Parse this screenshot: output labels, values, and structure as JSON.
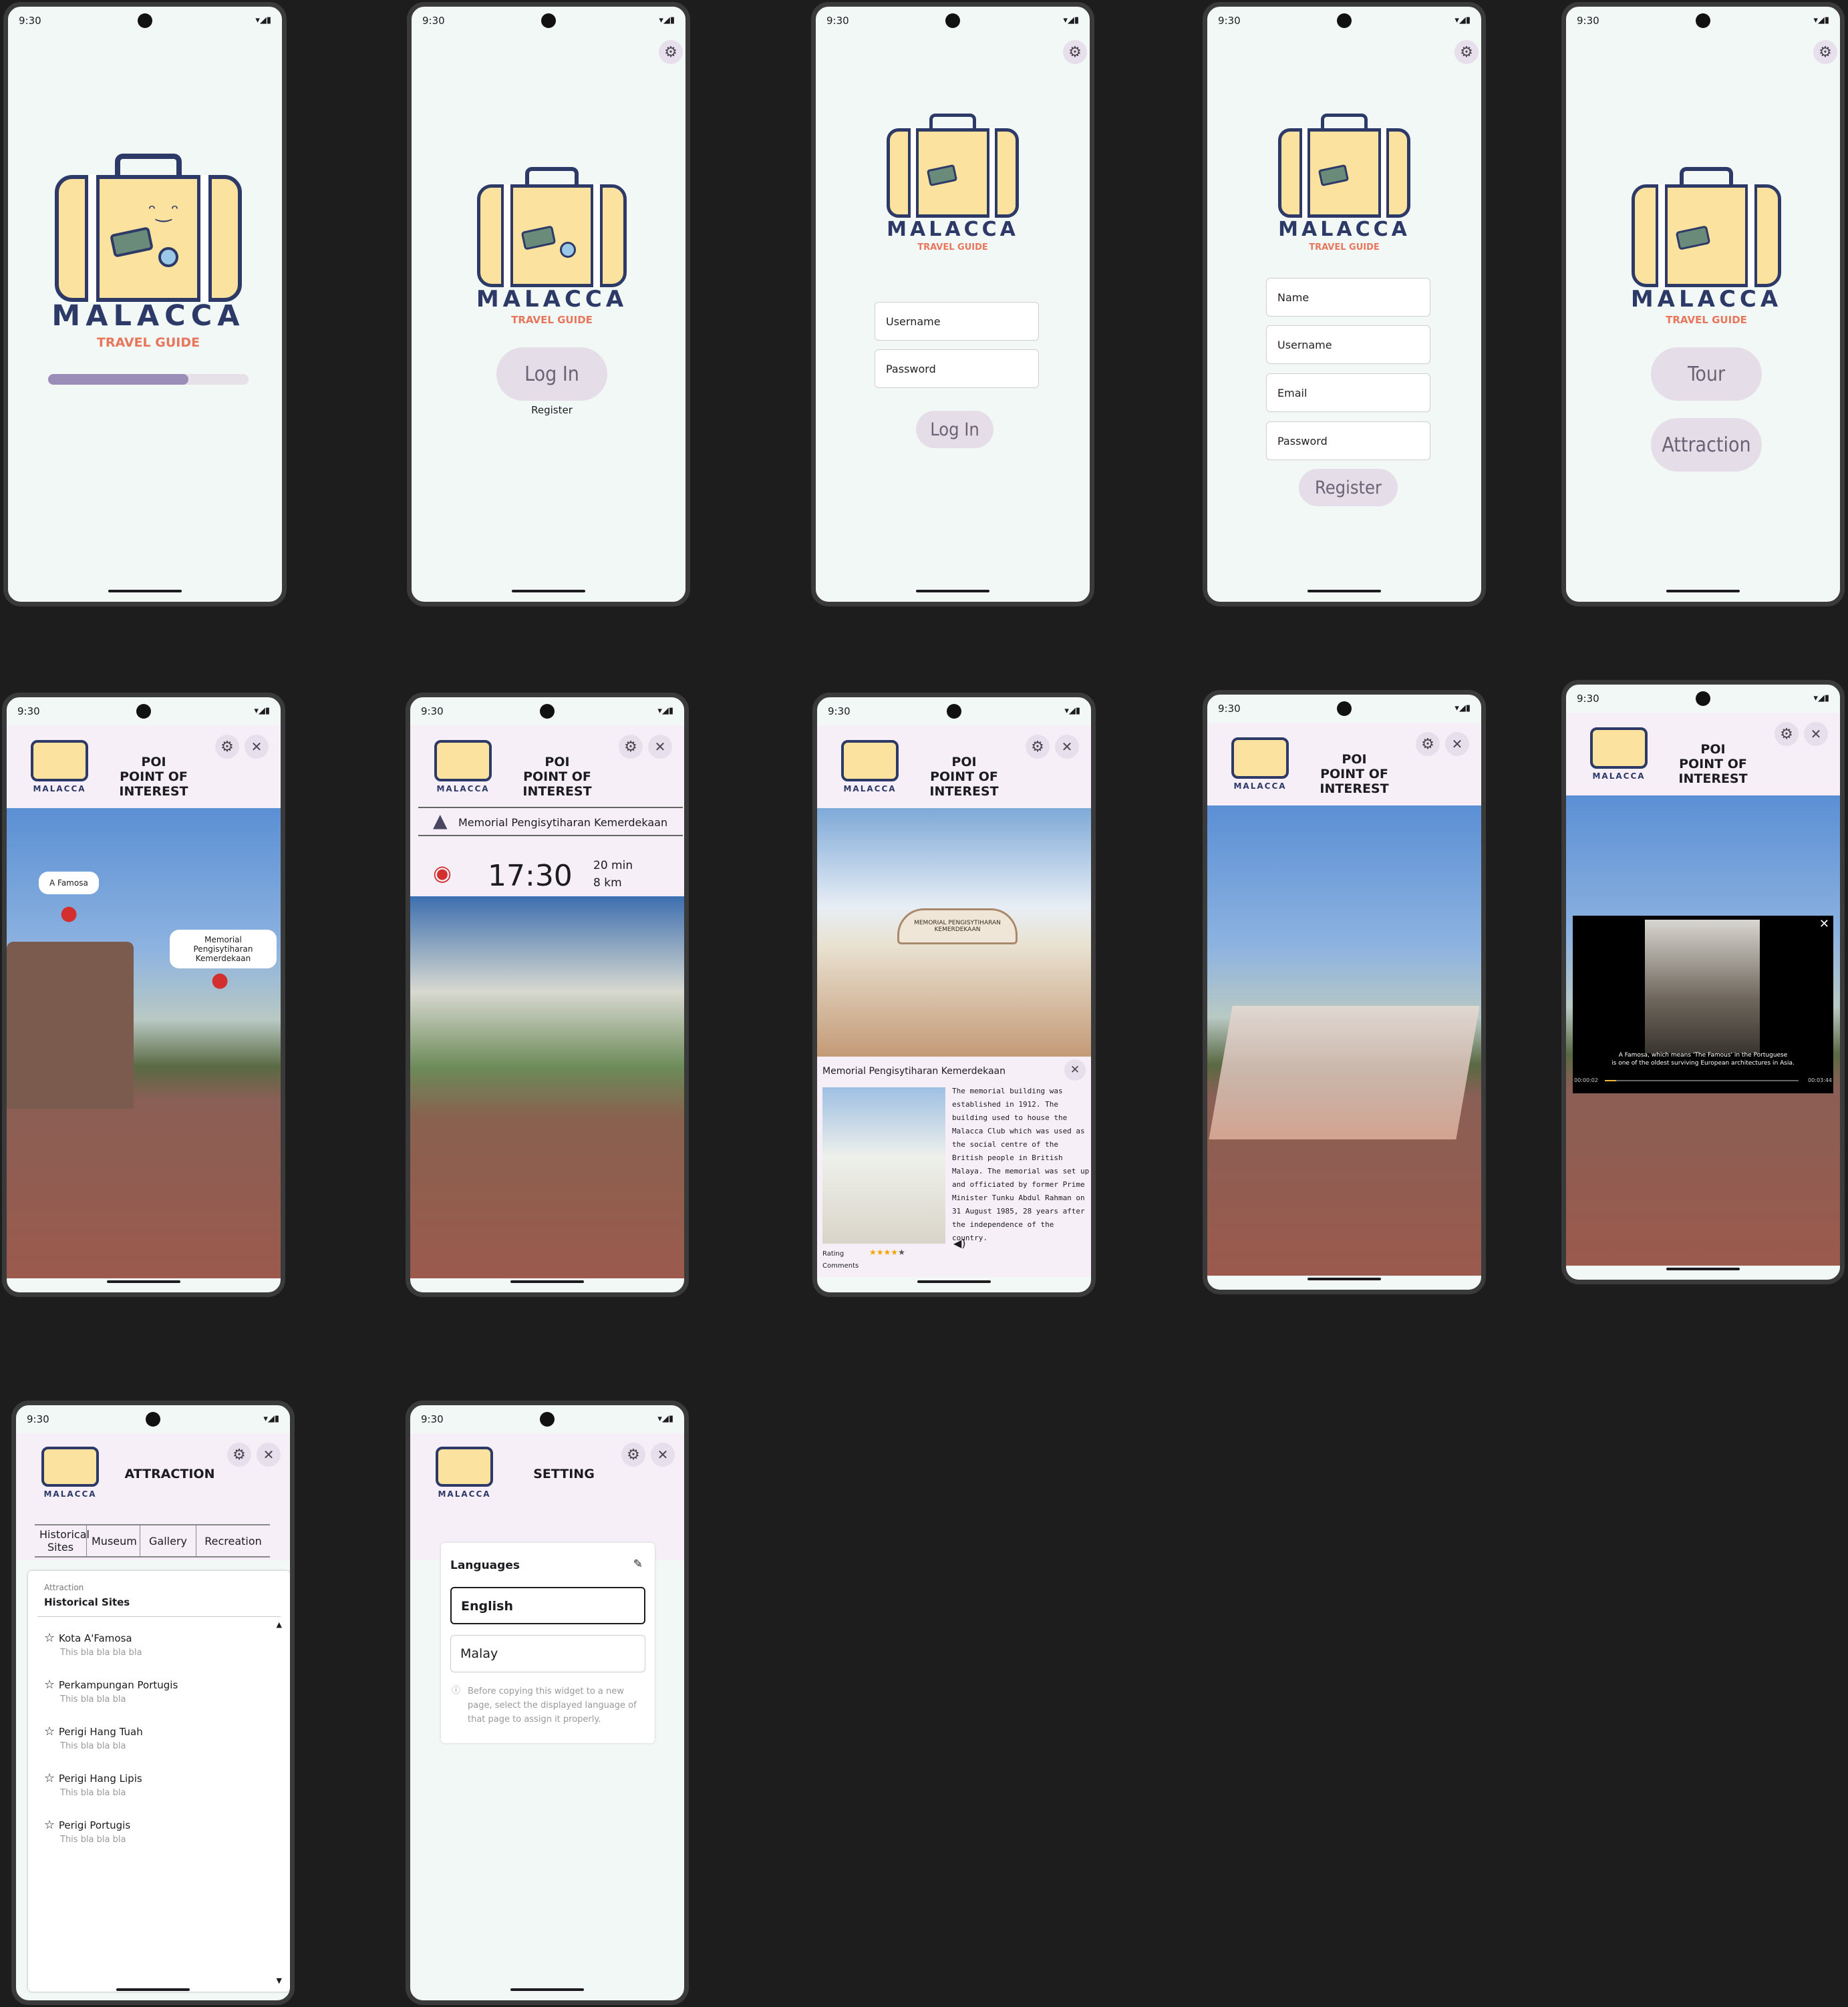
{
  "status": {
    "time": "9:30"
  },
  "brand": {
    "name": "MALACCA",
    "tagline": "TRAVEL GUIDE"
  },
  "splash": {
    "progress": 0.7
  },
  "login_choice": {
    "login": "Log In",
    "register": "Register"
  },
  "login_form": {
    "username": "Username",
    "password": "Password",
    "button": "Log In"
  },
  "register_form": {
    "name": "Name",
    "username": "Username",
    "email": "Email",
    "password": "Password",
    "button": "Register"
  },
  "menu": {
    "tour": "Tour",
    "attraction": "Attraction"
  },
  "poi": {
    "short": "POI",
    "long": "POINT OF INTEREST",
    "pin_a": "A Famosa",
    "pin_b": "Memorial Pengisytiharan Kemerdekaan"
  },
  "nav": {
    "destination": "Memorial Pengisytiharan Kemerdekaan",
    "eta": "17:30",
    "duration": "20 min",
    "distance": "8 km"
  },
  "detail": {
    "title": "Memorial Pengisytiharan Kemerdekaan",
    "sign": "MEMORIAL PENGISYTIHARAN KEMERDEKAAN",
    "text": "The memorial building was established in 1912. The building used to house the Malacca Club which was used as the social centre of the British people in British Malaya. The memorial was set up and officiated by former Prime Minister Tunku Abdul Rahman on 31 August 1985, 28 years after the independence of the country.",
    "rating_label": "Rating",
    "rating": 4,
    "comments_label": "Comments"
  },
  "video": {
    "caption1": "A Famosa, which means 'The Famous' in the Portuguese",
    "caption2": "is one of the oldest surviving European architectures in Asia.",
    "current": "00:00:02",
    "total": "00:03:44",
    "progress": 0.06
  },
  "attraction": {
    "title": "ATTRACTION",
    "tabs": [
      "Historical Sites",
      "Museum",
      "Gallery",
      "Recreation"
    ],
    "label": "Attraction",
    "selected": "Historical Sites",
    "items": [
      {
        "name": "Kota A'Famosa",
        "sub": "This bla bla bla bla"
      },
      {
        "name": "Perkampungan Portugis",
        "sub": "This bla bla bla"
      },
      {
        "name": "Perigi Hang Tuah",
        "sub": "This bla bla bla"
      },
      {
        "name": "Perigi Hang Lipis",
        "sub": "This bla bla bla"
      },
      {
        "name": "Perigi Portugis",
        "sub": "This bla bla bla"
      }
    ]
  },
  "setting": {
    "title": "SETTING",
    "languages": "Languages",
    "options": [
      "English",
      "Malay"
    ],
    "note": "Before copying this widget to a new page, select the displayed language of that page to assign it properly."
  },
  "colors": {
    "bg": "#1d1d1d",
    "screen": "#f1f8f5",
    "header": "#f6eff8",
    "pill": "#e5dde7",
    "pin": "#d32f2f",
    "accent": "#e8765c"
  }
}
